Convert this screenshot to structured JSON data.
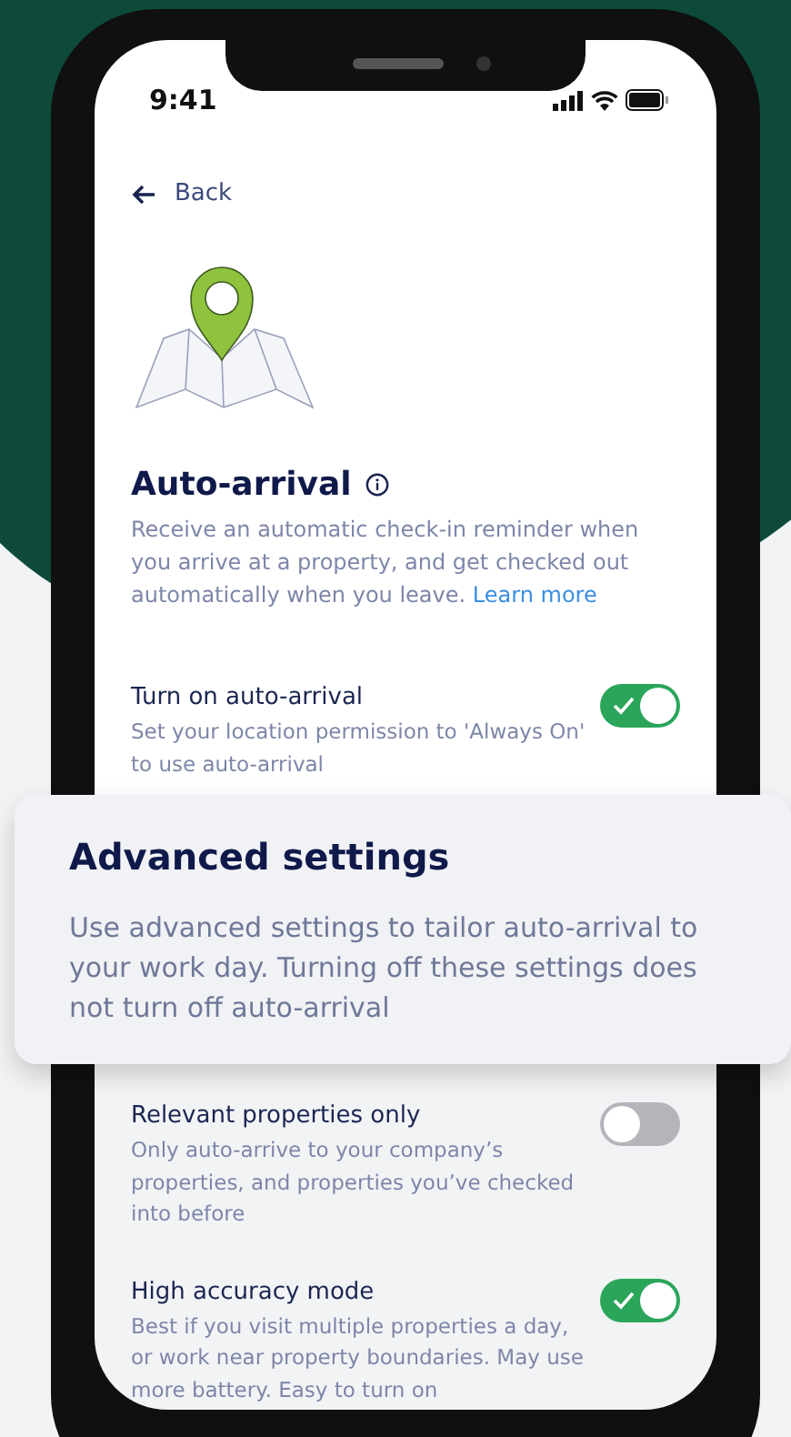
{
  "status_bar": {
    "time": "9:41"
  },
  "back": {
    "label": "Back"
  },
  "header": {
    "title": "Auto-arrival",
    "description": "Receive an automatic check-in reminder when you arrive at a property, and get checked out automatically when you leave.",
    "link": "Learn more"
  },
  "main_setting": {
    "title": "Turn on auto-arrival",
    "description": "Set your location permission to 'Always On' to use auto-arrival",
    "on": true
  },
  "advanced_card": {
    "title": "Advanced settings",
    "description": "Use advanced settings to tailor auto-arrival to your work day. Turning off these settings does not turn off auto-arrival"
  },
  "advanced_settings": [
    {
      "title": "Relevant properties only",
      "description": "Only auto-arrive to your company’s properties, and properties you’ve checked into before",
      "on": false
    },
    {
      "title": "High accuracy mode",
      "description": "Best if you visit multiple properties a day, or work near property boundaries. May use more battery. Easy to turn on",
      "on": true
    }
  ]
}
